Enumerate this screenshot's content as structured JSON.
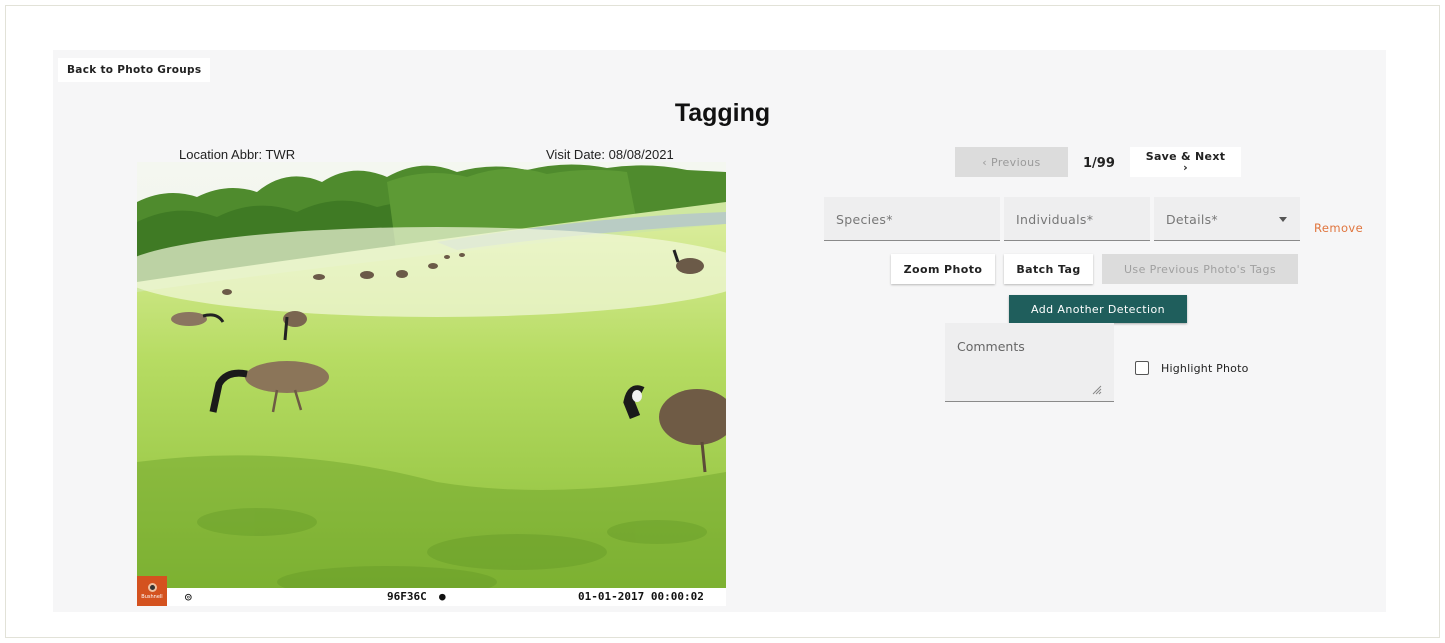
{
  "nav": {
    "back_label": "Back to Photo Groups"
  },
  "page": {
    "title": "Tagging"
  },
  "photo_meta": {
    "location": "Location Abbr: TWR",
    "visit_date": "Visit Date: 08/08/2021"
  },
  "photo": {
    "camera_id": "96F36C",
    "timestamp": "01-01-2017 00:00:02",
    "brand_text": "Bushnell"
  },
  "pager": {
    "previous_label": "‹ Previous",
    "counter": "1/99",
    "next_label": "Save & Next",
    "next_arrow": "›"
  },
  "detection": {
    "species_label": "Species*",
    "individuals_label": "Individuals*",
    "details_label": "Details*",
    "remove_label": "Remove"
  },
  "actions": {
    "zoom_label": "Zoom Photo",
    "batch_label": "Batch Tag",
    "use_previous_label": "Use Previous Photo's Tags",
    "add_detection_label": "Add Another Detection"
  },
  "comments": {
    "placeholder": "Comments"
  },
  "highlight": {
    "label": "Highlight Photo",
    "checked": false
  },
  "colors": {
    "accent_teal": "#1f5e5c",
    "remove_orange": "#e0753e",
    "panel_bg": "#f6f6f7"
  }
}
